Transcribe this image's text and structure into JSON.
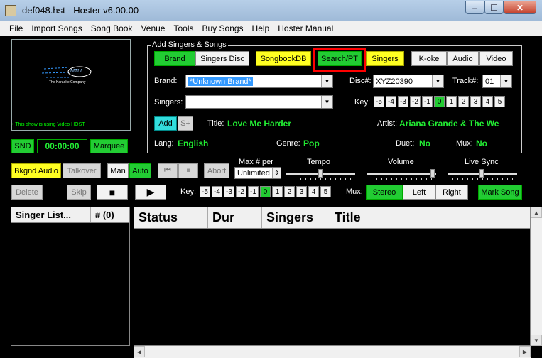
{
  "window": {
    "title": "def048.hst - Hoster v6.00.00",
    "min": "–",
    "max": "☐",
    "close": "✕"
  },
  "menu": [
    "File",
    "Import Songs",
    "Song Book",
    "Venue",
    "Tools",
    "Buy Songs",
    "Help",
    "Hoster Manual"
  ],
  "video": {
    "logo": "MTLL",
    "company": "The Karaoke Company",
    "status": "• This show is using Video HOST"
  },
  "top_left": {
    "snd": "SND",
    "timer": "00:00:00",
    "marquee": "Marquee"
  },
  "add_group": {
    "label": "Add Singers & Songs",
    "tabs": [
      "Brand",
      "Singers Disc",
      "SongbookDB",
      "Search/PT",
      "Singers"
    ],
    "tabs_right": [
      "K-oke",
      "Audio",
      "Video"
    ],
    "brand_label": "Brand:",
    "brand_value": "*Unknown Brand*",
    "disc_label": "Disc#:",
    "disc_value": "XYZ20390",
    "track_label": "Track#:",
    "track_value": "01",
    "singers_label": "Singers:",
    "singers_value": "",
    "key_label": "Key:",
    "keys": [
      "-5",
      "-4",
      "-3",
      "-2",
      "-1",
      "0",
      "1",
      "2",
      "3",
      "4",
      "5"
    ],
    "active_key": "0",
    "add": "Add",
    "splus": "S+",
    "title_label": "Title:",
    "title_value": "Love Me Harder",
    "artist_label": "Artist:",
    "artist_value": "Ariana Grande & The We",
    "lang_label": "Lang:",
    "lang_value": "English",
    "genre_label": "Genre:",
    "genre_value": "Pop",
    "duet_label": "Duet:",
    "duet_value": "No",
    "mux_label": "Mux:",
    "mux_value": "No"
  },
  "controls": {
    "bkgnd_audio": "Bkgnd Audio",
    "talkover": "Talkover",
    "man": "Man",
    "auto": "Auto",
    "prev": "⏮",
    "pause": "⏸",
    "abort": "Abort",
    "max_label": "Max # per",
    "max_value": "Unlimited",
    "tempo": "Tempo",
    "volume": "Volume",
    "live_sync": "Live Sync",
    "delete": "Delete",
    "skip": "Skip",
    "stop": "■",
    "play": "▶",
    "key_label": "Key:",
    "keys": [
      "-5",
      "-4",
      "-3",
      "-2",
      "-1",
      "0",
      "1",
      "2",
      "3",
      "4",
      "5"
    ],
    "active_key": "0",
    "mux_label": "Mux:",
    "stereo": "Stereo",
    "left": "Left",
    "right": "Right",
    "mark_song": "Mark Song"
  },
  "singer_list": {
    "col1": "Singer List...",
    "col2": "# (0)"
  },
  "queue": {
    "columns": [
      "Status",
      "Dur",
      "Singers",
      "Title"
    ]
  },
  "colors": {
    "accent_green": "#22cc33",
    "highlight_red": "#ff0000",
    "yellow": "#ffff22"
  }
}
